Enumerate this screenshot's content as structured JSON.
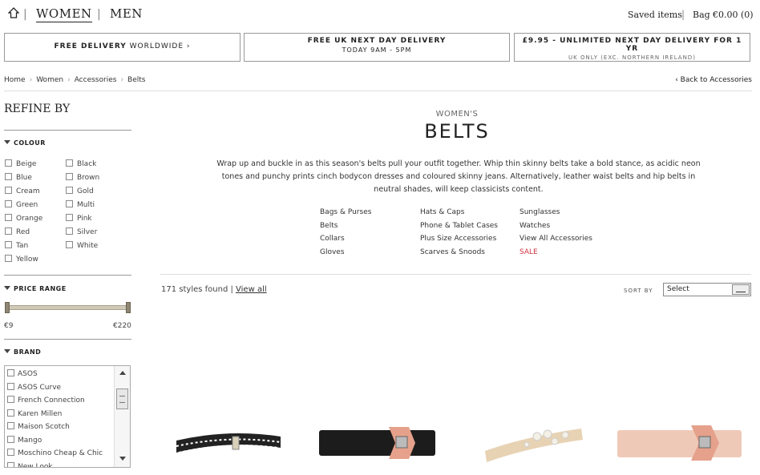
{
  "header": {
    "nav_women": "WOMEN",
    "nav_men": "MEN",
    "saved_items": "Saved items",
    "bag_label": "Bag",
    "bag_total": "€0.00 (0)"
  },
  "promos": [
    {
      "strong": "FREE DELIVERY",
      "light": " WORLDWIDE ›"
    },
    {
      "line1": "FREE UK NEXT DAY DELIVERY",
      "line2": "TODAY 9AM - 5PM"
    },
    {
      "line1": "£9.95 - UNLIMITED NEXT DAY DELIVERY FOR 1 YR",
      "line2": "UK ONLY (EXC. NORTHERN IRELAND)"
    }
  ],
  "breadcrumb": [
    "Home",
    "Women",
    "Accessories",
    "Belts"
  ],
  "back_link": "‹ Back to Accessories",
  "sidebar": {
    "title": "REFINE BY",
    "colour_label": "COLOUR",
    "colours_left": [
      "Beige",
      "Blue",
      "Cream",
      "Green",
      "Orange",
      "Red",
      "Tan",
      "Yellow"
    ],
    "colours_right": [
      "Black",
      "Brown",
      "Gold",
      "Multi",
      "Pink",
      "Silver",
      "White"
    ],
    "price_label": "PRICE RANGE",
    "price_min": "€9",
    "price_max": "€220",
    "brand_label": "BRAND",
    "brands": [
      "ASOS",
      "ASOS Curve",
      "French Connection",
      "Karen Millen",
      "Maison Scotch",
      "Mango",
      "Moschino Cheap & Chic",
      "New Look"
    ]
  },
  "main": {
    "subtitle": "WOMEN'S",
    "title": "BELTS",
    "description": "Wrap up and buckle in as this season's belts pull your outfit together. Whip thin skinny belts take a bold stance, as acidic neon tones and punchy prints cinch bodycon dresses and coloured skinny jeans. Alternatively, leather waist belts and hip belts in neutral shades, will keep classicists content.",
    "categories": [
      [
        "Bags & Purses",
        "Belts",
        "Collars",
        "Gloves"
      ],
      [
        "Hats & Caps",
        "Phone & Tablet Cases",
        "Plus Size Accessories",
        "Scarves & Snoods"
      ],
      [
        "Sunglasses",
        "Watches",
        "View All Accessories",
        "SALE"
      ]
    ],
    "styles_found": "171 styles found |",
    "view_all": "View all",
    "sort_label": "SORT BY",
    "sort_value": "Select"
  },
  "colors": {
    "sale": "#d0343f",
    "accent": "#8e8672"
  }
}
